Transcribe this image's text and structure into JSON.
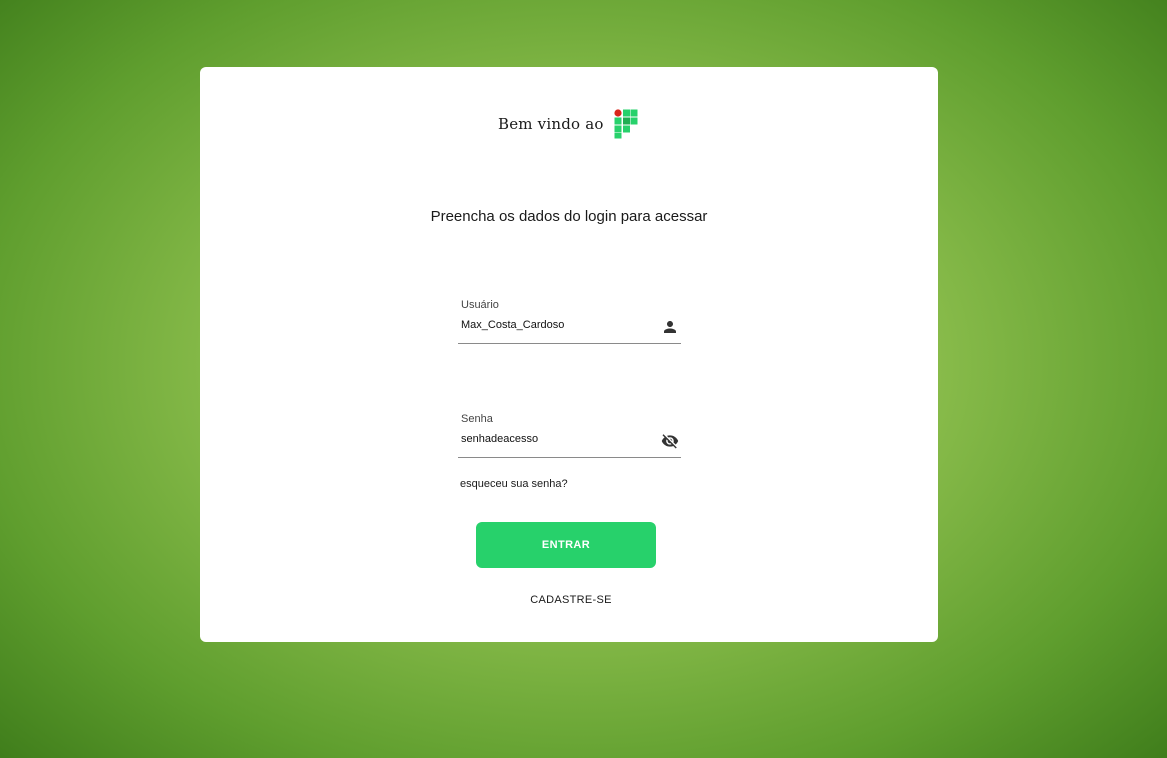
{
  "header": {
    "welcome_text": "Bem vindo ao",
    "logo_icon": "ifpr-logo-icon"
  },
  "subtitle": "Preencha os dados do login para acessar",
  "username": {
    "label": "Usuário",
    "value": "Max_Costa_Cardoso",
    "icon": "person-icon"
  },
  "password": {
    "label": "Senha",
    "value": "senhadeacesso",
    "icon": "eye-off-icon"
  },
  "forgot_link": "esqueceu sua senha?",
  "enter_button": "ENTRAR",
  "signup_link": "CADASTRE-SE",
  "colors": {
    "accent": "#27d16b",
    "background_green": "#5f9e2e",
    "card": "#ffffff"
  }
}
